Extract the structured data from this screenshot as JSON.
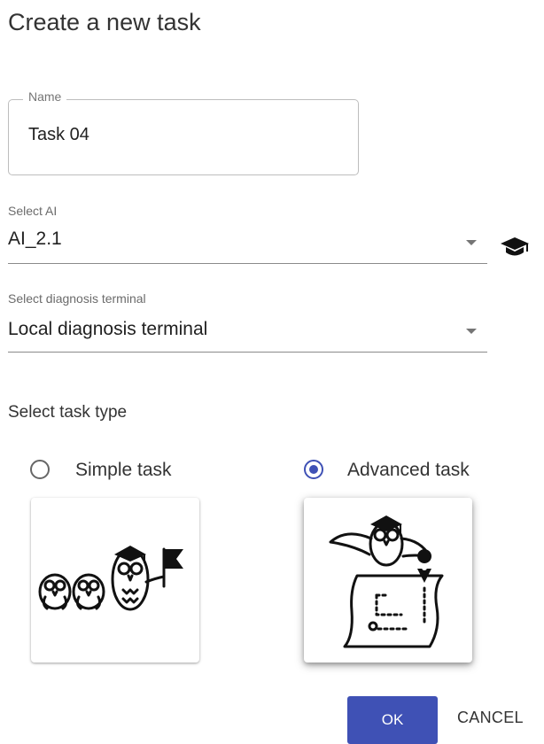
{
  "dialog": {
    "title": "Create a new task"
  },
  "name_field": {
    "label": "Name",
    "value": "Task 04"
  },
  "ai_select": {
    "label": "Select AI",
    "value": "AI_2.1",
    "icon": "graduation-cap-icon"
  },
  "terminal_select": {
    "label": "Select diagnosis terminal",
    "value": "Local diagnosis terminal"
  },
  "task_type": {
    "label": "Select task type",
    "options": [
      {
        "label": "Simple task",
        "selected": false
      },
      {
        "label": "Advanced task",
        "selected": true
      }
    ]
  },
  "actions": {
    "ok": "OK",
    "cancel": "CANCEL"
  },
  "colors": {
    "primary": "#3f51b5"
  }
}
